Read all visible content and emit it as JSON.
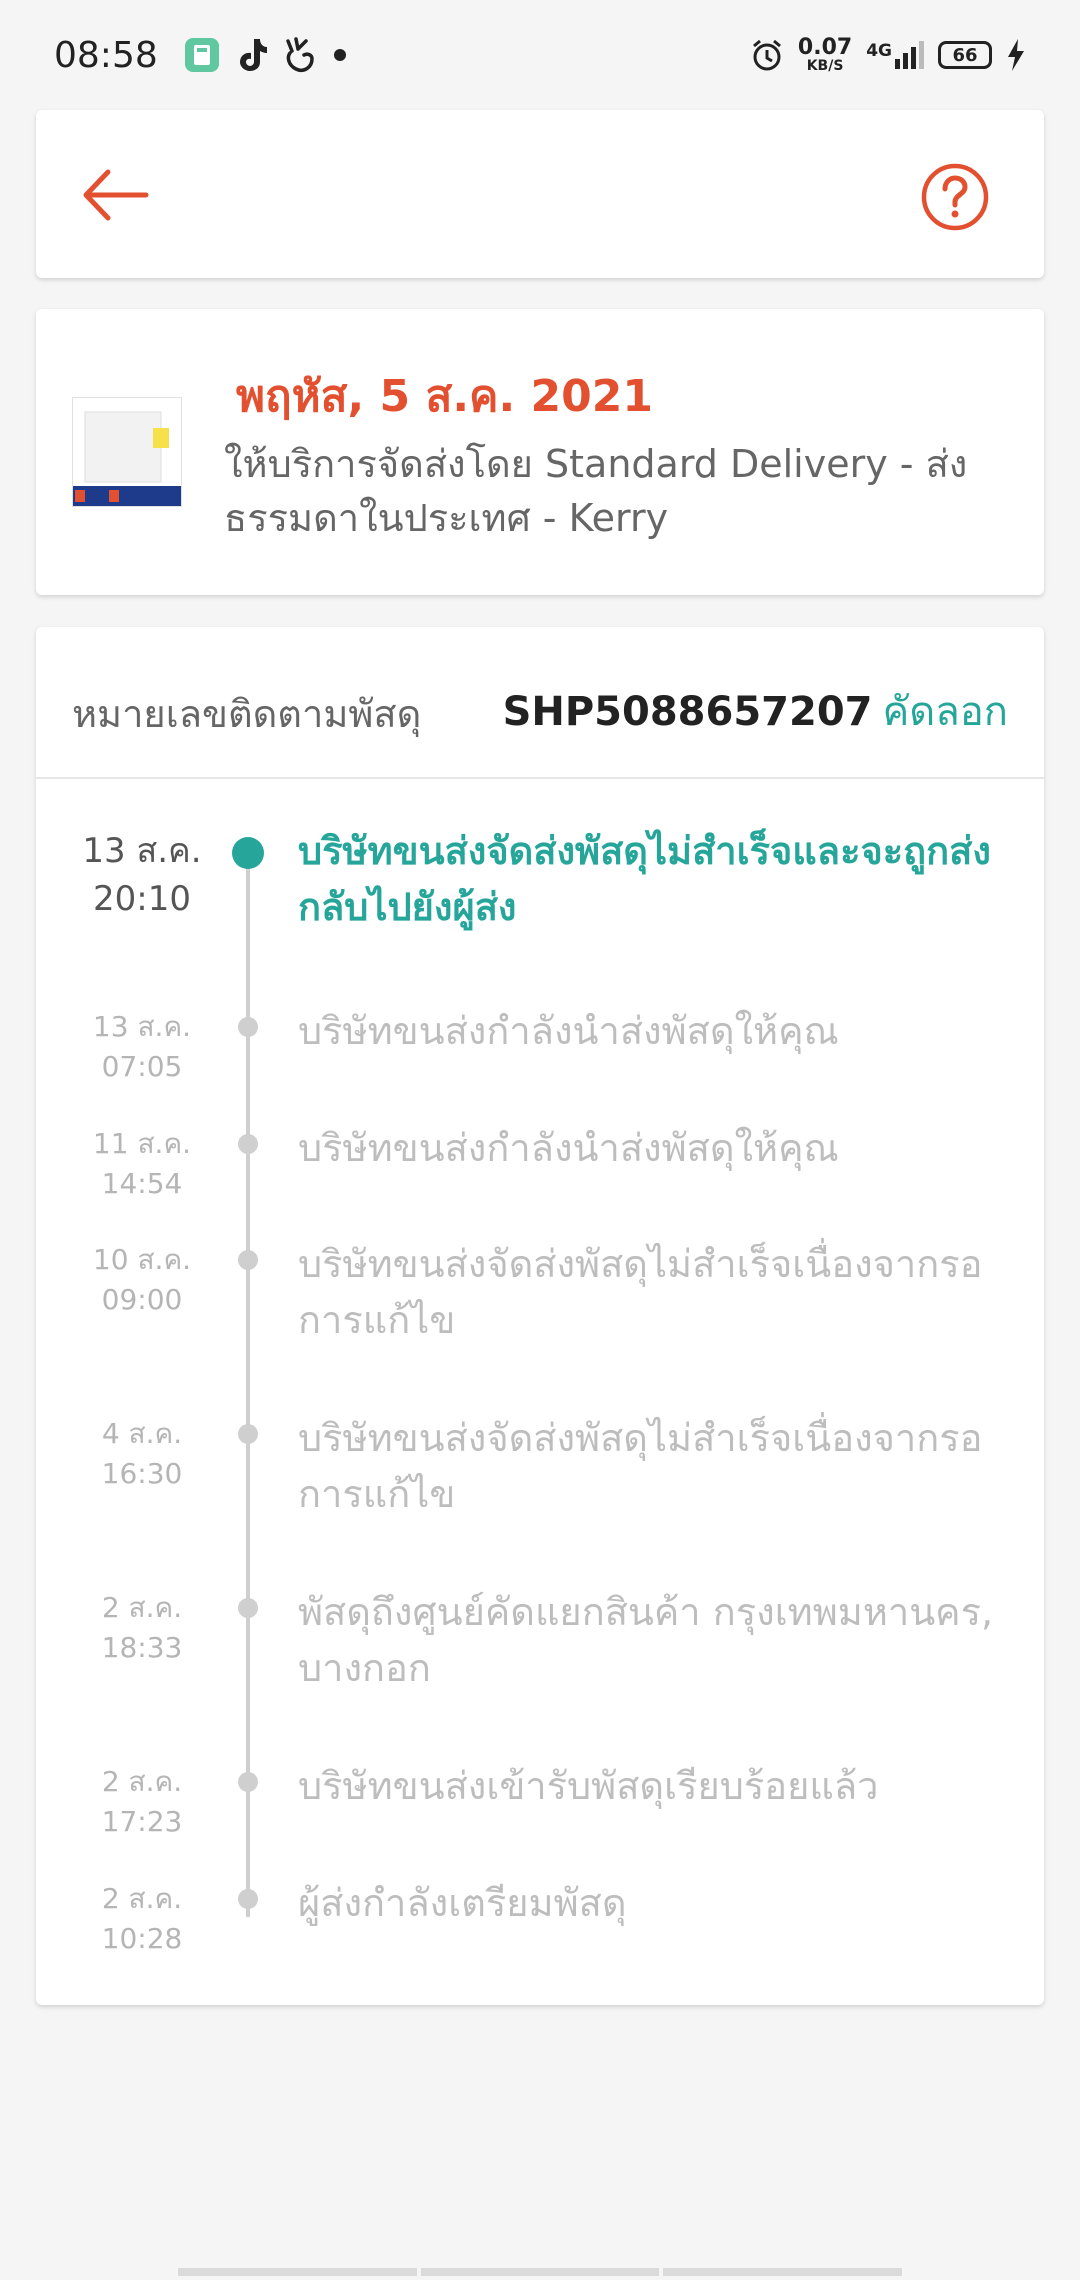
{
  "status_bar": {
    "time": "08:58",
    "net_speed_value": "0.07",
    "net_speed_unit": "KB/S",
    "network": "4G",
    "battery": "66",
    "icons": [
      "calculator-app-icon",
      "tiktok-icon",
      "hand-peace-icon",
      "notification-dot",
      "alarm-icon",
      "signal-icon",
      "charging-icon"
    ]
  },
  "header": {
    "back_icon": "arrow-left-icon",
    "help_icon": "question-circle-icon"
  },
  "delivery": {
    "date": "พฤหัส, 5 ส.ค. 2021",
    "info": "ให้บริการจัดส่งโดย Standard Delivery - ส่งธรรมดาในประเทศ - Kerry",
    "thumb_icon": "product-image"
  },
  "tracking": {
    "label": "หมายเลขติดตามพัสดุ",
    "number": "SHP5088657207",
    "copy_label": "คัดลอก",
    "events": [
      {
        "date": "13 ส.ค.",
        "time": "20:10",
        "desc": "บริษัทขนส่งจัดส่งพัสดุไม่สำเร็จและจะถูกส่งกลับไปยังผู้ส่ง"
      },
      {
        "date": "13 ส.ค.",
        "time": "07:05",
        "desc": "บริษัทขนส่งกำลังนำส่งพัสดุให้คุณ"
      },
      {
        "date": "11 ส.ค.",
        "time": "14:54",
        "desc": "บริษัทขนส่งกำลังนำส่งพัสดุให้คุณ"
      },
      {
        "date": "10 ส.ค.",
        "time": "09:00",
        "desc": "บริษัทขนส่งจัดส่งพัสดุไม่สำเร็จเนื่องจากรอการแก้ไข"
      },
      {
        "date": "4 ส.ค.",
        "time": "16:30",
        "desc": "บริษัทขนส่งจัดส่งพัสดุไม่สำเร็จเนื่องจากรอการแก้ไข"
      },
      {
        "date": "2 ส.ค.",
        "time": "18:33",
        "desc": "พัสดุถึงศูนย์คัดแยกสินค้า กรุงเทพมหานคร, บางกอก"
      },
      {
        "date": "2 ส.ค.",
        "time": "17:23",
        "desc": "บริษัทขนส่งเข้ารับพัสดุเรียบร้อยแล้ว"
      },
      {
        "date": "2 ส.ค.",
        "time": "10:28",
        "desc": "ผู้ส่งกำลังเตรียมพัสดุ"
      }
    ]
  },
  "colors": {
    "accent": "#e3502f",
    "teal": "#26a69a",
    "muted": "#bdbdbd"
  }
}
